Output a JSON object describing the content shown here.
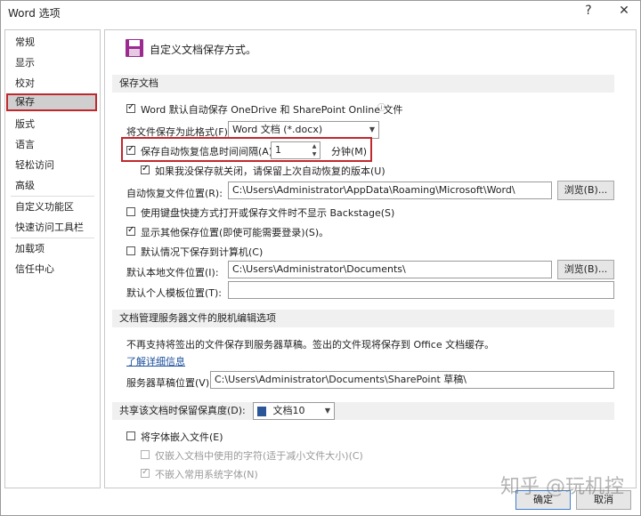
{
  "window": {
    "title": "Word 选项",
    "help_glyph": "?",
    "close_glyph": "✕"
  },
  "nav": {
    "items": [
      {
        "label": "常规"
      },
      {
        "label": "显示"
      },
      {
        "label": "校对"
      },
      {
        "label": "保存",
        "selected": true
      },
      {
        "label": "版式"
      },
      {
        "label": "语言"
      },
      {
        "label": "轻松访问"
      },
      {
        "label": "高级"
      },
      {
        "label": "自定义功能区"
      },
      {
        "label": "快速访问工具栏"
      },
      {
        "label": "加载项"
      },
      {
        "label": "信任中心"
      }
    ]
  },
  "header": {
    "icon": "save-disk-icon",
    "text": "自定义文档保存方式。"
  },
  "save_docs": {
    "section_title": "保存文档",
    "autosave_label": "Word 默认自动保存 OneDrive 和 SharePoint Online 文件",
    "autosave_checked": true,
    "format_label": "将文件保存为此格式(F):",
    "format_value": "Word 文档 (*.docx)",
    "autorecover_label": "保存自动恢复信息时间间隔(A)",
    "autorecover_checked": true,
    "autorecover_minutes": "1",
    "minutes_label": "分钟(M)",
    "keep_last_label": "如果我没保存就关闭，请保留上次自动恢复的版本(U)",
    "keep_last_checked": true,
    "autorecover_location_label": "自动恢复文件位置(R):",
    "autorecover_location_value": "C:\\Users\\Administrator\\AppData\\Roaming\\Microsoft\\Word\\",
    "browse_label": "浏览(B)...",
    "no_backstage_label": "使用键盘快捷方式打开或保存文件时不显示 Backstage(S)",
    "no_backstage_checked": false,
    "show_other_label": "显示其他保存位置(即使可能需要登录)(S)。",
    "show_other_checked": true,
    "default_computer_label": "默认情况下保存到计算机(C)",
    "default_computer_checked": false,
    "local_location_label": "默认本地文件位置(I):",
    "local_location_value": "C:\\Users\\Administrator\\Documents\\",
    "browse2_label": "浏览(B)...",
    "template_location_label": "默认个人模板位置(T):",
    "template_location_value": ""
  },
  "server": {
    "section_title": "文档管理服务器文件的脱机编辑选项",
    "info_text": "不再支持将签出的文件保存到服务器草稿。签出的文件现将保存到 Office 文档缓存。",
    "learn_more": "了解详细信息",
    "drafts_label": "服务器草稿位置(V):",
    "drafts_value": "C:\\Users\\Administrator\\Documents\\SharePoint 草稿\\"
  },
  "fidelity": {
    "section_title": "共享该文档时保留保真度(D):",
    "doc_value": "文档10",
    "embed_fonts_label": "将字体嵌入文件(E)",
    "embed_fonts_checked": false,
    "only_used_label": "仅嵌入文档中使用的字符(适于减小文件大小)(C)",
    "only_used_checked": false,
    "no_common_label": "不嵌入常用系统字体(N)",
    "no_common_checked": true
  },
  "footer": {
    "ok_label": "确定",
    "cancel_label": "取消"
  },
  "watermark": "知乎 @玩机控"
}
